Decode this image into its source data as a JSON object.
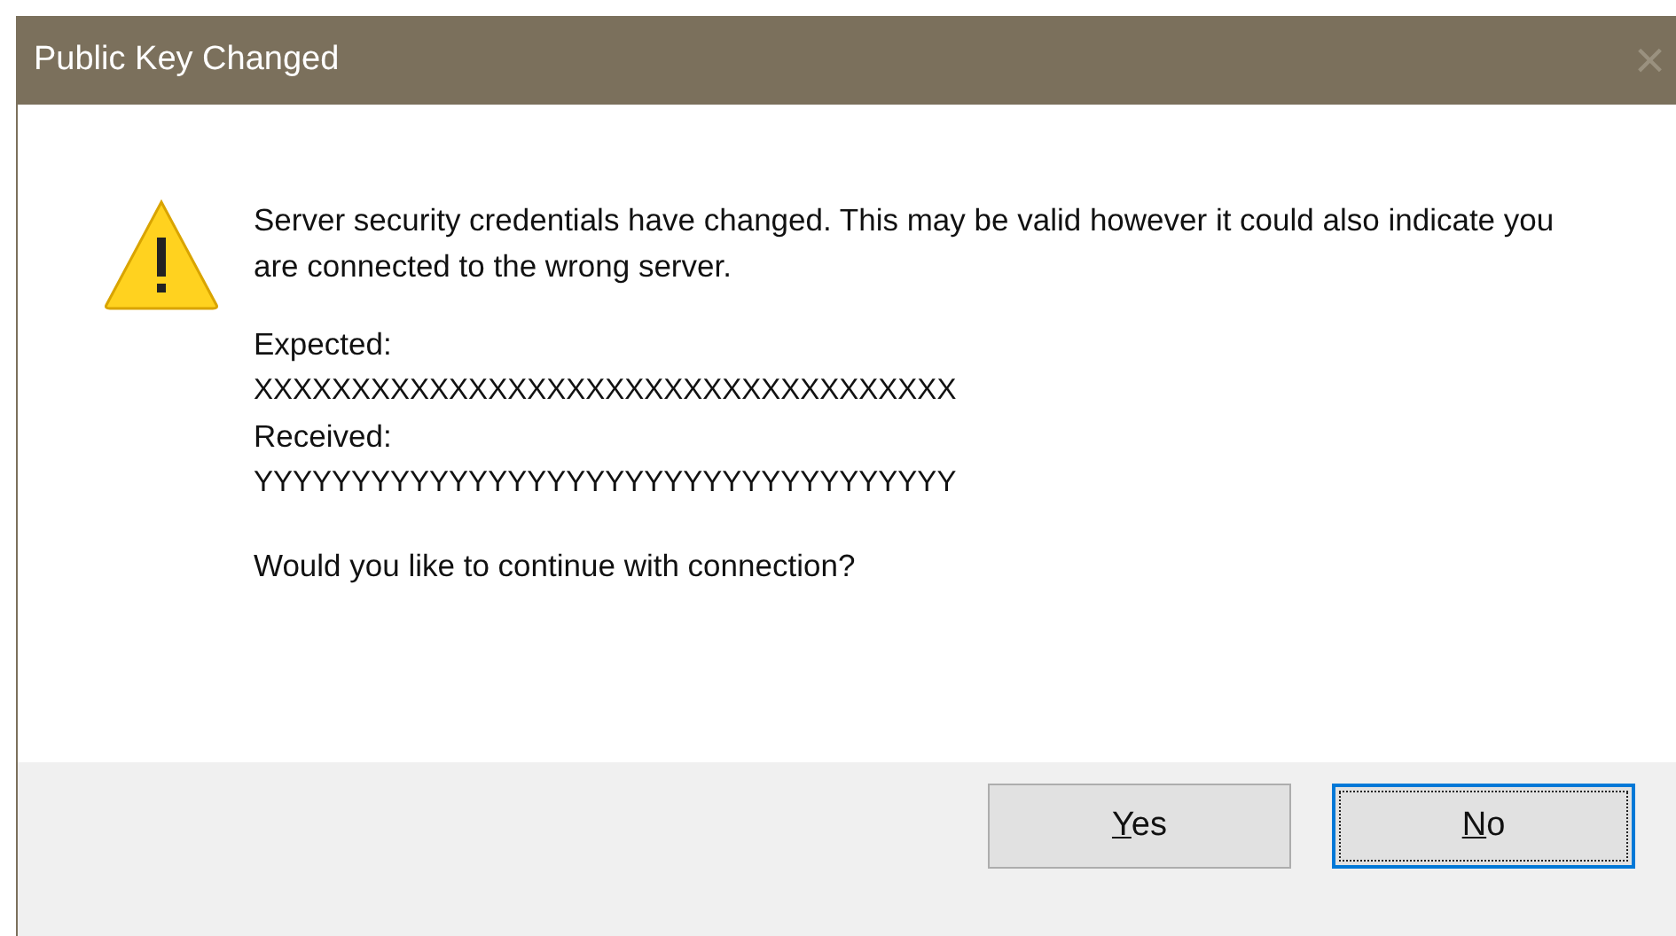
{
  "window": {
    "title": "Public Key Changed",
    "close": "×"
  },
  "message": "Server security credentials have changed. This may be valid however it could also indicate you are connected to the wrong server.",
  "details": [
    {
      "label": "Expected:",
      "value": "XXXXXXXXXXXXXXXXXXXXXXXXXXXXXXXXXXXX"
    },
    {
      "label": "Received:",
      "value": "YYYYYYYYYYYYYYYYYYYYYYYYYYYYYYYYYYYY"
    }
  ],
  "question": "Would you like to continue with connection?",
  "buttons": [
    {
      "label": "Yes",
      "default": false
    },
    {
      "label": "No",
      "default": true
    }
  ]
}
